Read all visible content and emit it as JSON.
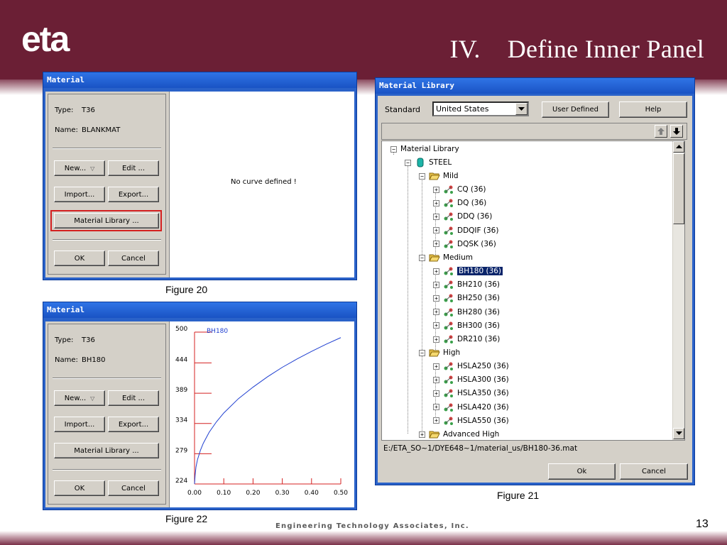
{
  "slide": {
    "logo_text": "eta",
    "title_number": "IV.",
    "title_text": "Define Inner Panel",
    "footer": "Engineering Technology Associates, Inc.",
    "page_number": "13"
  },
  "captions": {
    "fig20": "Figure  20",
    "fig21": "Figure  21",
    "fig22": "Figure  22"
  },
  "colors": {
    "header": "#6b1f35",
    "window_titlebar": "#2a62c9",
    "selection": "#0a246a",
    "highlight_box": "#d42020",
    "curve": "#1f3fd0"
  },
  "material_window_top": {
    "title": "Material",
    "type_label": "Type:",
    "type_value": "T36",
    "name_label": "Name:",
    "name_value": "BLANKMAT",
    "new_button": "New...",
    "edit_button": "Edit ...",
    "import_button": "Import...",
    "export_button": "Export...",
    "library_button": "Material Library ...",
    "ok_button": "OK",
    "cancel_button": "Cancel",
    "curve_message": "No curve defined !"
  },
  "material_window_bottom": {
    "title": "Material",
    "type_label": "Type:",
    "type_value": "T36",
    "name_label": "Name:",
    "name_value": "BH180",
    "new_button": "New...",
    "edit_button": "Edit ...",
    "import_button": "Import...",
    "export_button": "Export...",
    "library_button": "Material Library ...",
    "ok_button": "OK",
    "cancel_button": "Cancel"
  },
  "chart_data": {
    "type": "line",
    "title": "BH180",
    "series": [
      {
        "name": "BH180",
        "x": [
          0.0,
          0.002,
          0.005,
          0.01,
          0.02,
          0.03,
          0.05,
          0.075,
          0.1,
          0.15,
          0.2,
          0.25,
          0.3,
          0.35,
          0.4,
          0.45,
          0.5
        ],
        "y": [
          224,
          240,
          255,
          268,
          285,
          298,
          318,
          337,
          353,
          379,
          400,
          419,
          436,
          451,
          465,
          478,
          490
        ]
      }
    ],
    "x_ticks": [
      "0.00",
      "0.10",
      "0.20",
      "0.30",
      "0.40",
      "0.50"
    ],
    "y_ticks": [
      "224",
      "279",
      "334",
      "389",
      "444",
      "500"
    ],
    "xlim": [
      0,
      0.5
    ],
    "ylim": [
      224,
      500
    ],
    "grid": false
  },
  "library_window": {
    "title": "Material Library",
    "standard_label": "Standard",
    "standard_value": "United States",
    "user_defined_button": "User Defined",
    "help_button": "Help",
    "ok_button": "Ok",
    "cancel_button": "Cancel",
    "path": "E:/ETA_SO~1/DYE648~1/material_us/BH180-36.mat",
    "tree": {
      "root": "Material Library",
      "steel": "STEEL",
      "mild": "Mild",
      "mild_items": [
        "CQ  (36)",
        "DQ  (36)",
        "DDQ  (36)",
        "DDQIF  (36)",
        "DQSK  (36)"
      ],
      "medium": "Medium",
      "medium_items": [
        "BH180  (36)",
        "BH210  (36)",
        "BH250  (36)",
        "BH280  (36)",
        "BH300  (36)",
        "DR210  (36)"
      ],
      "high": "High",
      "high_items": [
        "HSLA250  (36)",
        "HSLA300  (36)",
        "HSLA350  (36)",
        "HSLA420  (36)",
        "HSLA550  (36)"
      ],
      "advanced_high": "Advanced High"
    }
  }
}
